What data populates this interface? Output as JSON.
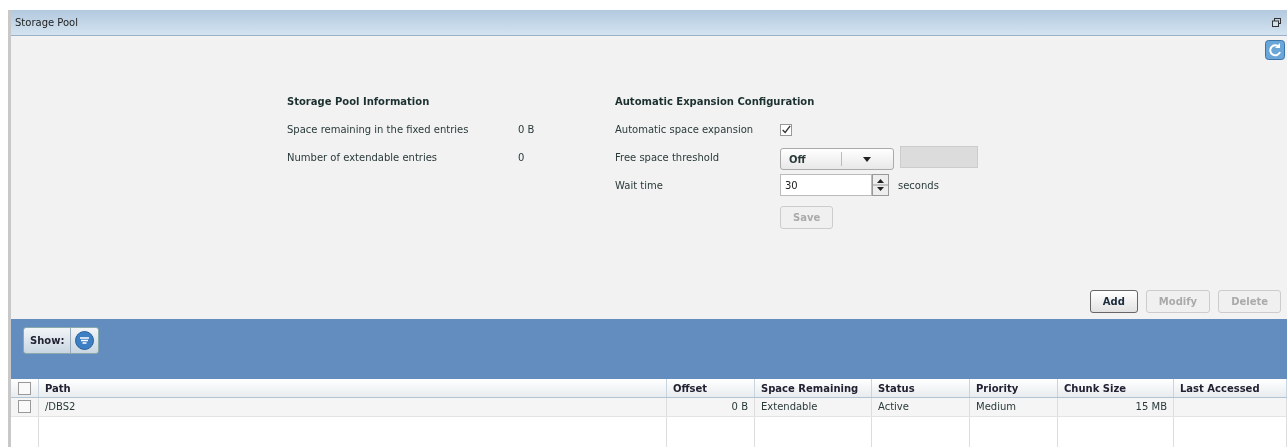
{
  "window": {
    "title": "Storage Pool"
  },
  "info": {
    "title": "Storage Pool Information",
    "rows": [
      {
        "label": "Space remaining in the fixed entries",
        "value": "0 B"
      },
      {
        "label": "Number of extendable entries",
        "value": "0"
      }
    ]
  },
  "expansion": {
    "title": "Automatic Expansion Configuration",
    "auto_label": "Automatic space expansion",
    "auto_checked": true,
    "threshold_label": "Free space threshold",
    "threshold_value": "Off",
    "threshold_field_disabled": true,
    "wait_label": "Wait time",
    "wait_value": "30",
    "wait_unit": "seconds",
    "save": {
      "label": "Save",
      "disabled": true
    }
  },
  "actions": [
    {
      "label": "Add",
      "disabled": false
    },
    {
      "label": "Modify",
      "disabled": true
    },
    {
      "label": "Delete",
      "disabled": true
    }
  ],
  "show_label": "Show:",
  "table": {
    "select_all_checked": false,
    "columns": [
      {
        "label": "Path",
        "kind": "text"
      },
      {
        "label": "Offset",
        "kind": "numeric"
      },
      {
        "label": "Space Remaining",
        "kind": "text"
      },
      {
        "label": "Status",
        "kind": "text"
      },
      {
        "label": "Priority",
        "kind": "text"
      },
      {
        "label": "Chunk Size",
        "kind": "numeric"
      },
      {
        "label": "Last Accessed",
        "kind": "text"
      }
    ],
    "rows": [
      {
        "checked": false,
        "cells": [
          "/DBS2",
          "0 B",
          "Extendable",
          "Active",
          "Medium",
          "15 MB",
          ""
        ]
      }
    ]
  }
}
